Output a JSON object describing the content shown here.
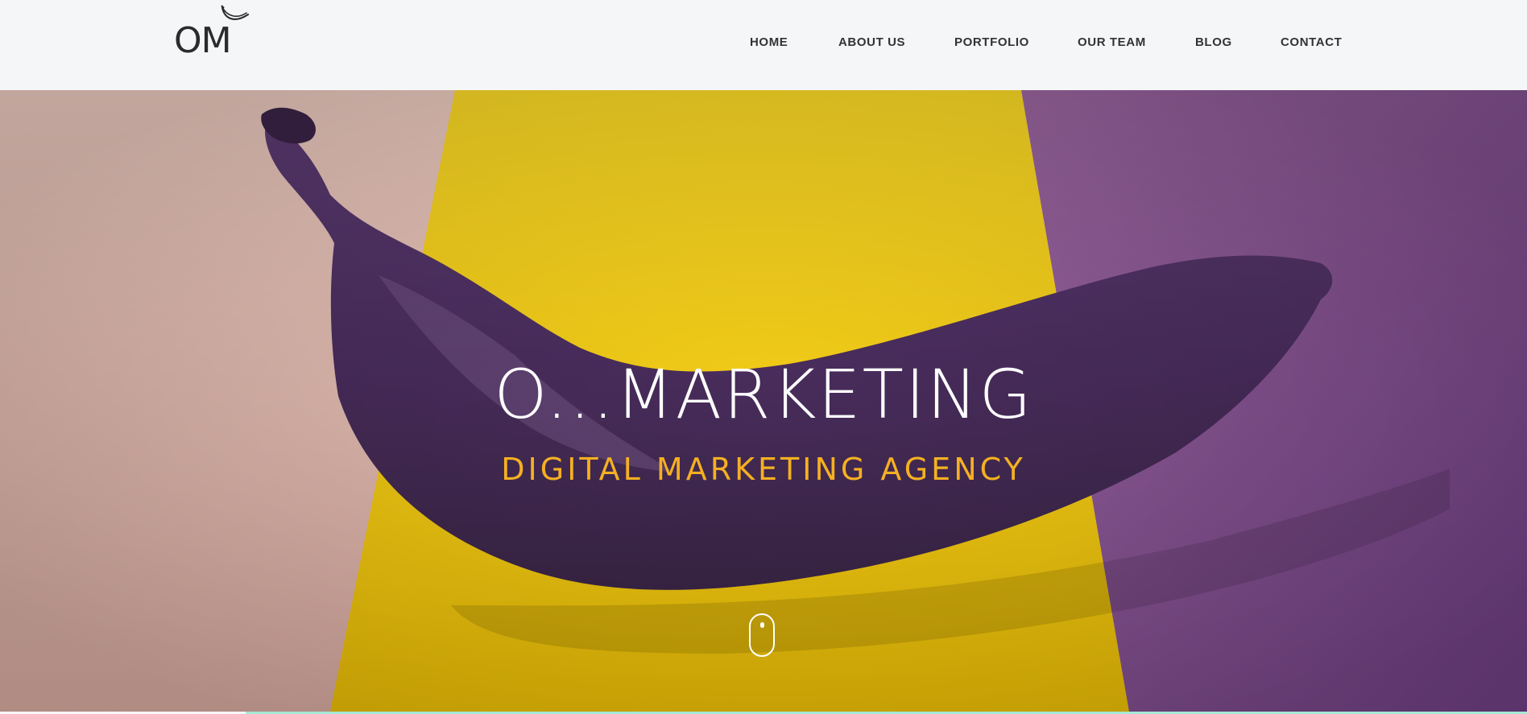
{
  "header": {
    "logo_text": "OM",
    "nav": [
      {
        "label": "HOME"
      },
      {
        "label": "ABOUT US"
      },
      {
        "label": "PORTFOLIO"
      },
      {
        "label": "OUR TEAM"
      },
      {
        "label": "BLOG"
      },
      {
        "label": "CONTACT"
      }
    ]
  },
  "hero": {
    "title": "O...MARKETING",
    "subtitle": "DIGITAL MARKETING AGENCY",
    "colors": {
      "pink": "#e9c5bb",
      "yellow": "#f6cf08",
      "purple_bg": "#7e4a8f",
      "banana": "#4a2f5c",
      "subtitle": "#f5b022"
    }
  }
}
